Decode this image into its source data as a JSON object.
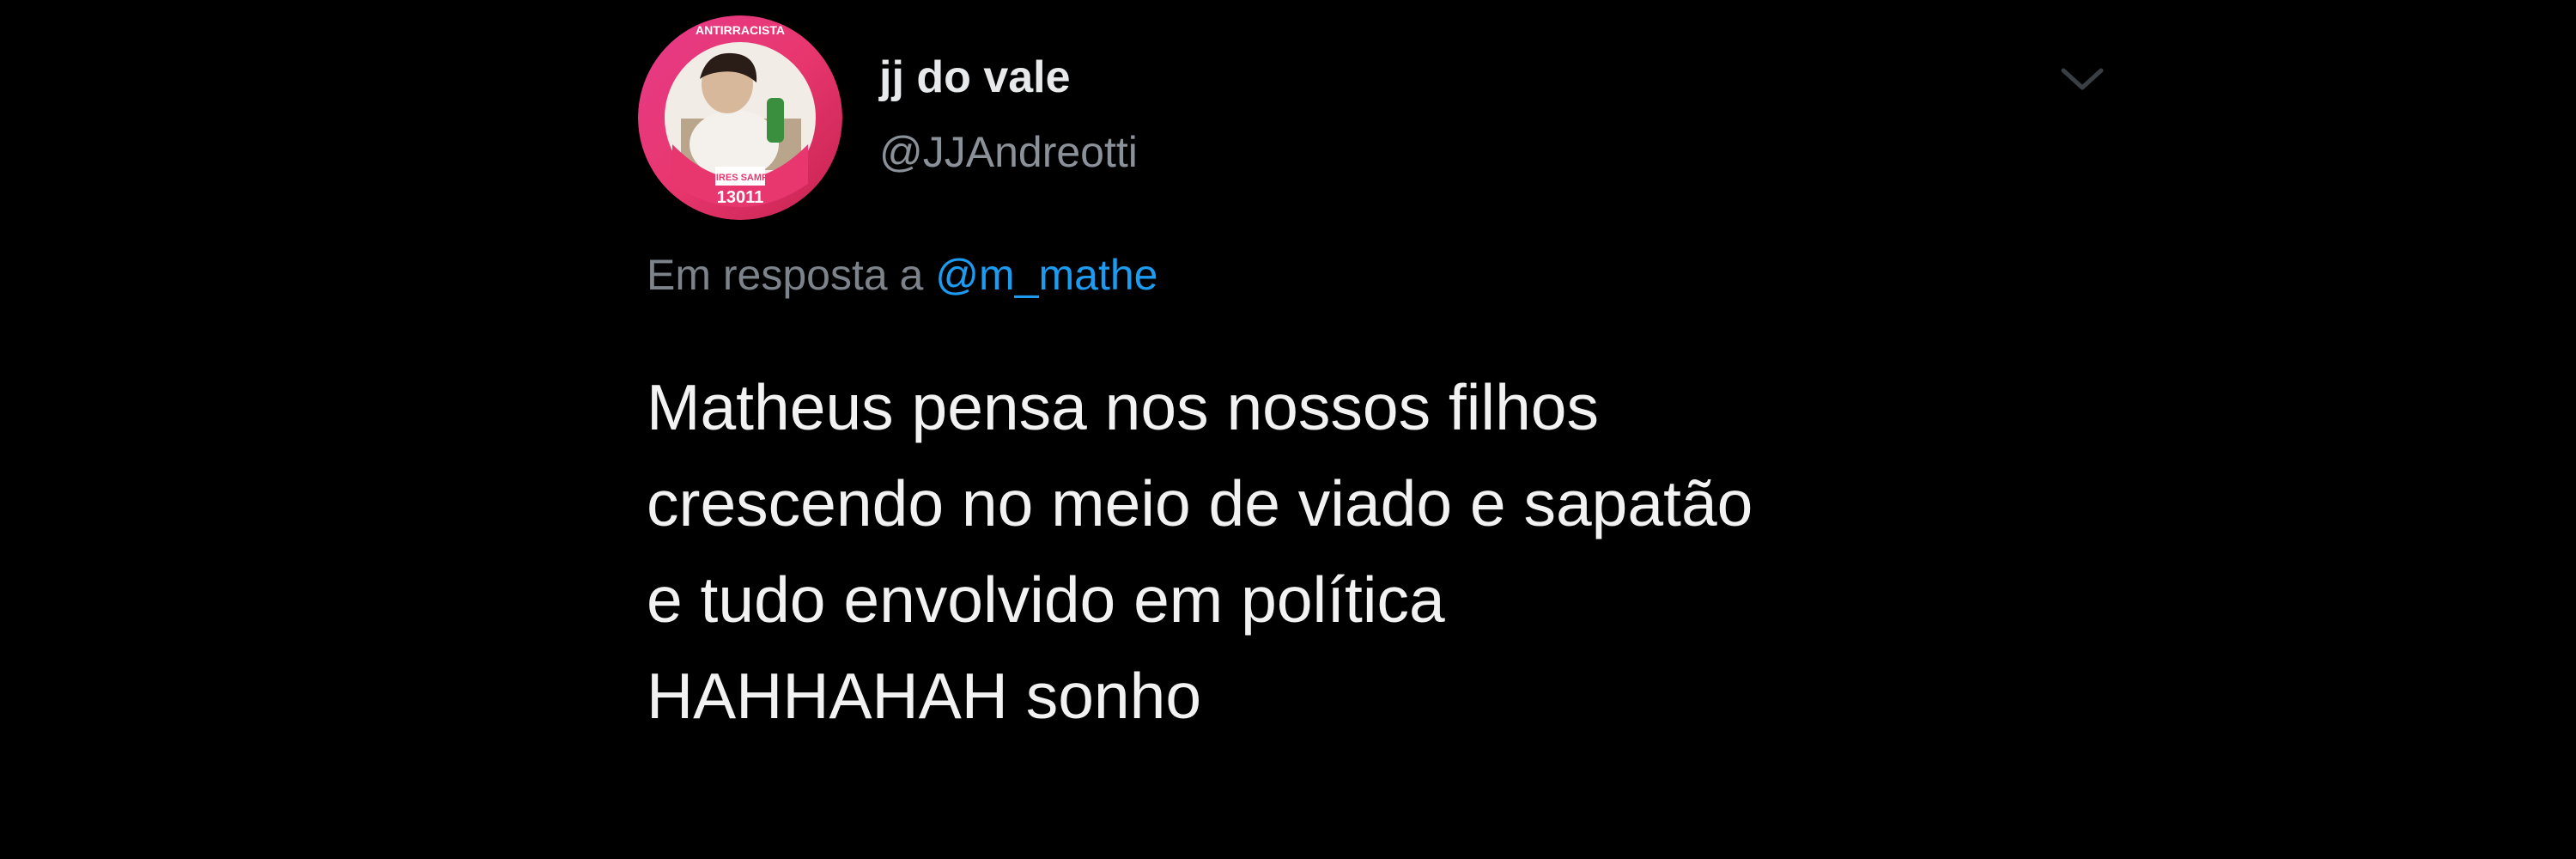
{
  "tweet": {
    "display_name": "jj do vale",
    "handle": "@JJAndreotti",
    "reply_prefix": "Em resposta a",
    "reply_mention": "@m_mathe",
    "text_lines": [
      "Matheus pensa nos nossos filhos",
      "crescendo no meio de viado e sapatão",
      "e tudo envolvido em política",
      "HAHHAHAH sonho"
    ]
  },
  "avatar_frame": {
    "banner_text": "ANTIRRACISTA",
    "name_text": "TAMIRES SAMPAIO",
    "number_text": "13011"
  },
  "icons": {
    "menu": "chevron-down-icon"
  },
  "colors": {
    "background": "#000000",
    "text": "#f2f2f2",
    "secondary_text": "#8b9198",
    "mention": "#1d9bf0",
    "avatar_ring": "#e8376f"
  }
}
